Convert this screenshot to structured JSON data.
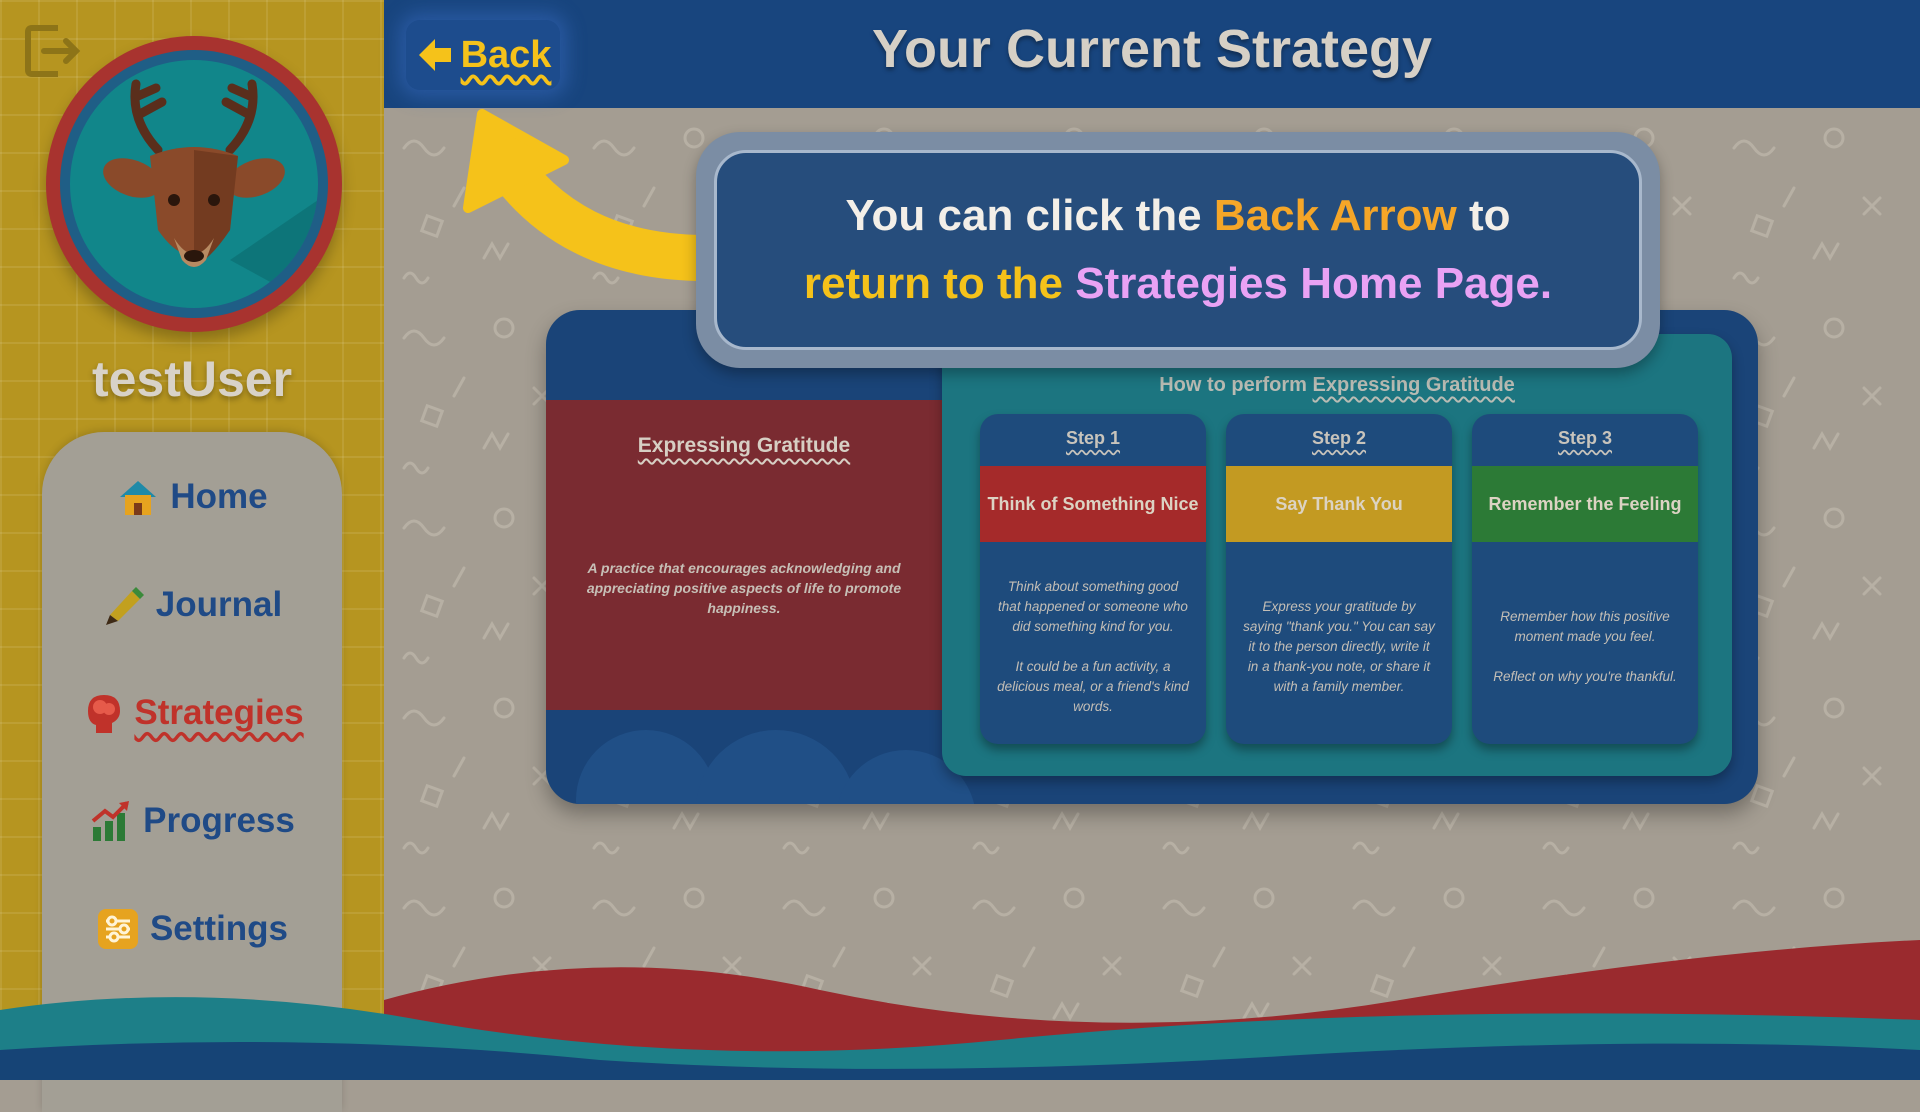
{
  "app": {
    "user": {
      "name": "testUser"
    }
  },
  "nav": {
    "items": [
      {
        "label": "Home",
        "icon": "home-icon"
      },
      {
        "label": "Journal",
        "icon": "pencil-icon"
      },
      {
        "label": "Strategies",
        "icon": "brain-head-icon",
        "active": true
      },
      {
        "label": "Progress",
        "icon": "chart-arrow-icon"
      },
      {
        "label": "Settings",
        "icon": "sliders-icon"
      }
    ]
  },
  "header": {
    "title": "Your Current Strategy",
    "back_label": "Back"
  },
  "callout": {
    "line1": {
      "a": "You can click the ",
      "b": "Back Arrow",
      "c": " to"
    },
    "line2": {
      "a": "return to the ",
      "b": "Strategies Home Page."
    }
  },
  "strategy": {
    "name": "Expressing Gratitude",
    "description": "A practice that encourages acknowledging and appreciating positive aspects of life to promote happiness.",
    "steps_heading": {
      "prefix": "How to perform ",
      "name": "Expressing Gratitude"
    },
    "steps": [
      {
        "label": "Step 1",
        "title": "Think of Something Nice",
        "color": "#a52a2a",
        "text": "Think about something good that happened or someone who did something kind for you.\n\nIt could be a fun activity, a delicious meal, or a friend's kind words."
      },
      {
        "label": "Step 2",
        "title": "Say Thank You",
        "color": "#c39a22",
        "text": "Express your gratitude by saying \"thank you.\" You can say it to the person directly, write it in a thank-you note, or share it with a family member."
      },
      {
        "label": "Step 3",
        "title": "Remember the Feeling",
        "color": "#2c7a36",
        "text": "Remember how this positive moment made you feel.\n\nReflect on why you're thankful."
      }
    ]
  },
  "colors": {
    "sidebar": "#b69520",
    "topbar": "#18457e",
    "accent_yellow": "#f5c21a",
    "accent_orange": "#f5a628",
    "accent_purple": "#e9a2f4",
    "active_red": "#c0322a"
  }
}
